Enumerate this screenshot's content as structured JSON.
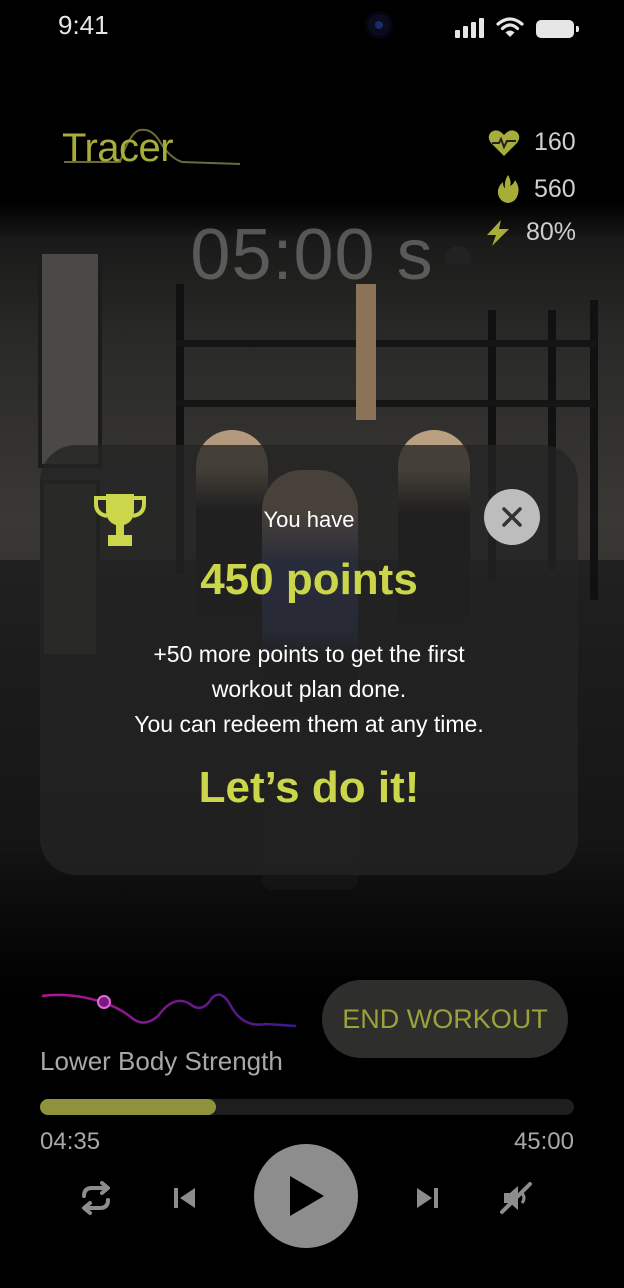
{
  "status_bar": {
    "time": "9:41"
  },
  "header": {
    "brand": "Tracer"
  },
  "stats": [
    {
      "icon": "heart-rate-icon",
      "value": "160"
    },
    {
      "icon": "flame-icon",
      "value": "560"
    },
    {
      "icon": "lightning-icon",
      "value": "80%"
    }
  ],
  "timer": "05:00 s",
  "modal": {
    "title": "You have",
    "points": "450 points",
    "message_line1": "+50 more points to get the first",
    "message_line2": "workout plan done.",
    "message_line3": "You can redeem them at any time.",
    "cta": "Let’s do it!"
  },
  "player": {
    "end_button": "END WORKOUT",
    "workout_name": "Lower Body Strength",
    "elapsed": "04:35",
    "total": "45:00",
    "progress": 0.33
  },
  "colors": {
    "accent": "#cbd64b",
    "brand": "#a8ad3a",
    "progress": "#8e923c",
    "wave": "#8a1f9e"
  }
}
